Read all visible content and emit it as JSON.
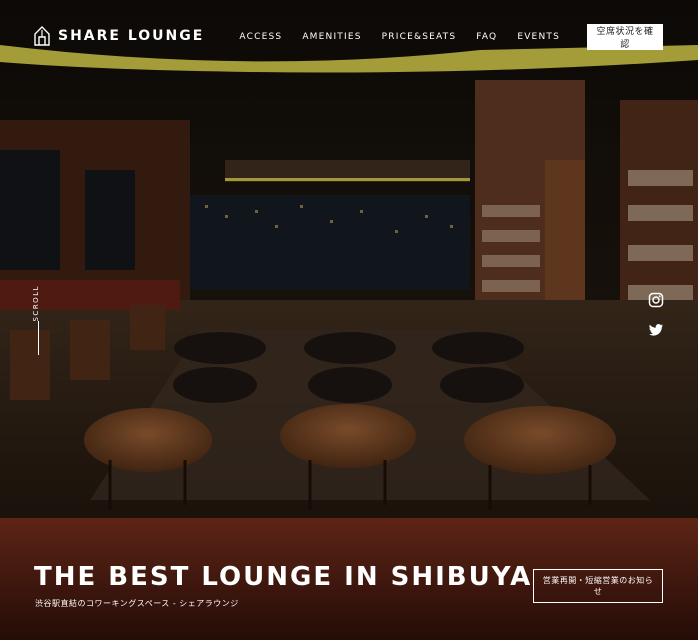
{
  "brand": {
    "name": "SHARE LOUNGE"
  },
  "nav": {
    "items": [
      {
        "label": "ACCESS"
      },
      {
        "label": "AMENITIES"
      },
      {
        "label": "PRICE&SEATS"
      },
      {
        "label": "FAQ"
      },
      {
        "label": "EVENTS"
      }
    ],
    "vacancy_button": "空席状況を確認"
  },
  "scroll": {
    "label": "SCROLL"
  },
  "social": {
    "icons": [
      "instagram-icon",
      "twitter-icon"
    ]
  },
  "hero": {
    "headline": "THE BEST LOUNGE IN SHIBUYA",
    "subline": "渋谷駅直結のコワーキングスペース - シェアラウンジ",
    "notice_button": "営業再開・短縮営業のお知らせ"
  },
  "colors": {
    "accent": "#d8d04a",
    "text": "#ffffff",
    "wood": "#6b3e22"
  }
}
